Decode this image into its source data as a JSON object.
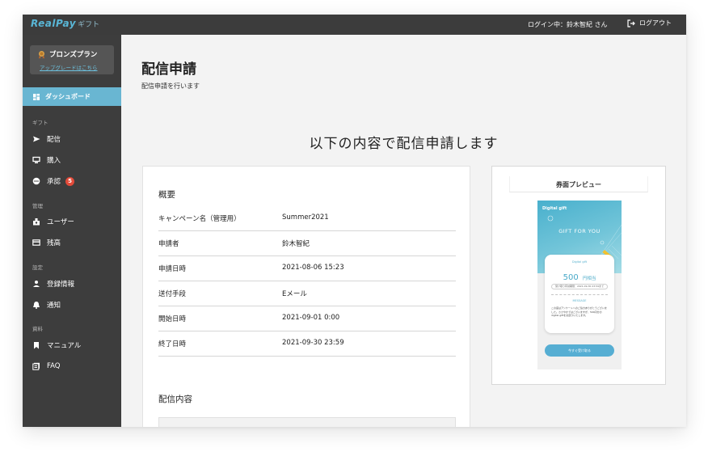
{
  "app": {
    "brand_main": "RealPay",
    "brand_sub": "ギフト",
    "login_status": "ログイン中：鈴木智紀 さん",
    "logout_label": "ログアウト"
  },
  "sidebar": {
    "plan_name": "ブロンズプラン",
    "upgrade_link": "アップグレードはこちら",
    "dashboard_label": "ダッシュボード",
    "sections": [
      {
        "title": "ギフト",
        "items": [
          {
            "label": "配信",
            "icon": "send-icon"
          },
          {
            "label": "購入",
            "icon": "cart-icon"
          },
          {
            "label": "承認",
            "icon": "approve-icon",
            "badge": "5"
          }
        ]
      },
      {
        "title": "管理",
        "items": [
          {
            "label": "ユーザー",
            "icon": "user-group-icon"
          },
          {
            "label": "残高",
            "icon": "card-icon"
          }
        ]
      },
      {
        "title": "設定",
        "items": [
          {
            "label": "登録情報",
            "icon": "person-icon"
          },
          {
            "label": "通知",
            "icon": "bell-icon"
          }
        ]
      },
      {
        "title": "資料",
        "items": [
          {
            "label": "マニュアル",
            "icon": "bookmark-icon"
          },
          {
            "label": "FAQ",
            "icon": "faq-icon"
          }
        ]
      }
    ]
  },
  "main": {
    "page_title": "配信申請",
    "page_subtitle": "配信申請を行います",
    "headline": "以下の内容で配信申請します",
    "summary": {
      "heading": "概要",
      "rows": [
        {
          "label": "キャンペーン名（管理用）",
          "value": "Summer2021"
        },
        {
          "label": "申請者",
          "value": "鈴木智紀"
        },
        {
          "label": "申請日時",
          "value": "2021-08-06 15:23"
        },
        {
          "label": "送付手段",
          "value": "Eメール"
        },
        {
          "label": "開始日時",
          "value": "2021-09-01 0:00"
        },
        {
          "label": "終了日時",
          "value": "2021-09-30 23:59"
        }
      ],
      "content_heading": "配信内容"
    },
    "preview": {
      "title": "券面プレビュー",
      "voucher": {
        "digital_gift": "Digital gift",
        "gift_for_you": "GIFT FOR YOU",
        "small_caption": "Digital gift",
        "amount": "500",
        "amount_unit": "円相当",
        "expiry": "受け取り有効期限：2021-09-30 23:59まで",
        "message_title": "MESSAGE",
        "message": "この度はアンケートへのご協力ありがとうございました。ささやかではございますが、500円分のdigital giftをお送りいたします。",
        "button": "今すぐ受け取る"
      }
    }
  },
  "colors": {
    "accent": "#69b6d2",
    "sidebar_bg": "#3d3d3d",
    "topbar_bg": "#3c3c3c",
    "badge": "#e24b3a"
  }
}
